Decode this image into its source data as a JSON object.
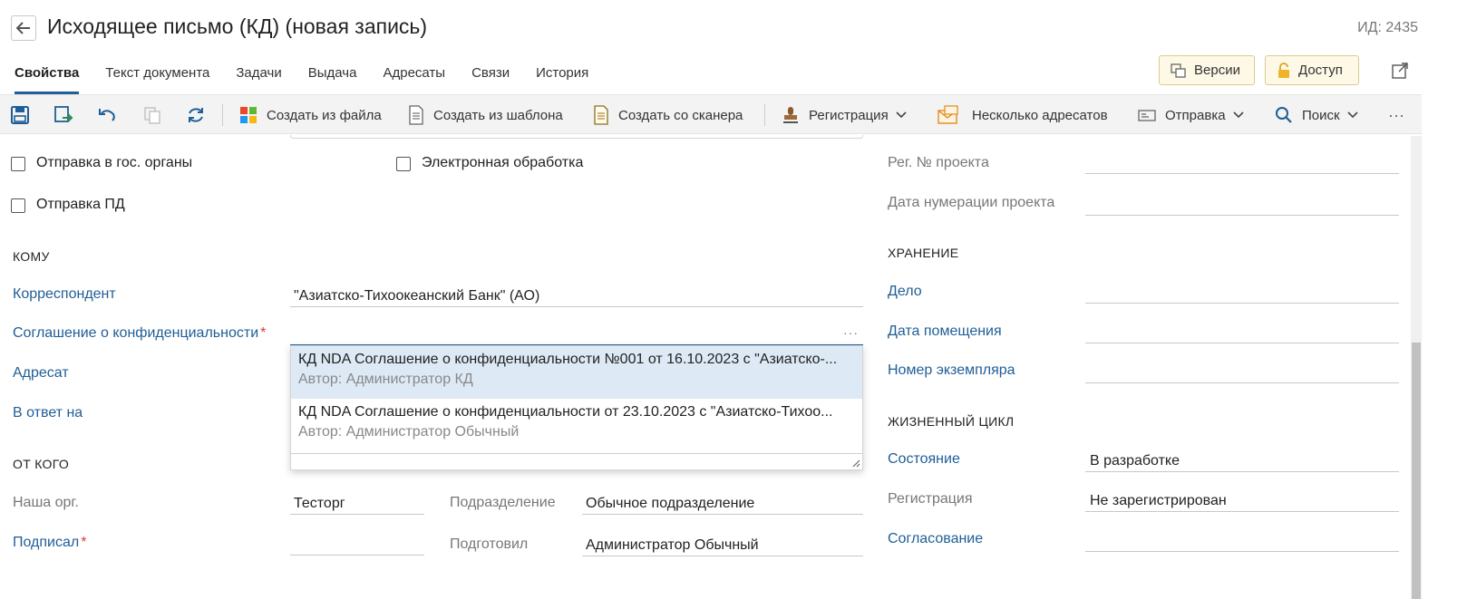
{
  "header": {
    "title": "Исходящее письмо (КД) (новая запись)",
    "id_label": "ИД: 2435"
  },
  "tabs": [
    {
      "label": "Свойства",
      "active": true
    },
    {
      "label": "Текст документа"
    },
    {
      "label": "Задачи"
    },
    {
      "label": "Выдача"
    },
    {
      "label": "Адресаты"
    },
    {
      "label": "Связи"
    },
    {
      "label": "История"
    }
  ],
  "header_buttons": {
    "versions": "Версии",
    "access": "Доступ"
  },
  "toolbar": {
    "create_from_file": "Создать из файла",
    "create_from_template": "Создать из шаблона",
    "create_from_scanner": "Создать со сканера",
    "registration": "Регистрация",
    "multiple_recipients": "Несколько адресатов",
    "sending": "Отправка",
    "search": "Поиск",
    "more": "···"
  },
  "checkboxes": {
    "gov_sending": "Отправка в гос. органы",
    "electronic_processing": "Электронная обработка",
    "pd_sending": "Отправка ПД"
  },
  "sections": {
    "to": "КОМУ",
    "from": "ОТ КОГО",
    "storage": "ХРАНЕНИЕ",
    "lifecycle": "ЖИЗНЕННЫЙ ЦИКЛ"
  },
  "fields": {
    "correspondent_label": "Корреспондент",
    "correspondent_value": "\"Азиатско-Тихоокеанский Банк\" (АО)",
    "nda_label": "Соглашение о конфиденциальности",
    "addressee_label": "Адресат",
    "reply_to_label": "В ответ на",
    "our_org_label": "Наша орг.",
    "our_org_value": "Тесторг",
    "department_label": "Подразделение",
    "department_value": "Обычное подразделение",
    "signed_label": "Подписал",
    "prepared_label": "Подготовил",
    "prepared_value": "Администратор Обычный",
    "reg_no_label": "Рег. № проекта",
    "numbering_date_label": "Дата нумерации проекта",
    "case_label": "Дело",
    "placement_date_label": "Дата помещения",
    "copy_number_label": "Номер экземпляра",
    "state_label": "Состояние",
    "state_value": "В разработке",
    "registration_label": "Регистрация",
    "registration_value": "Не зарегистрирован",
    "approval_label": "Согласование",
    "required_mark": "*",
    "ellipsis": "···"
  },
  "dropdown": {
    "items": [
      {
        "title": "КД NDA Соглашение о конфиденциальности №001 от 16.10.2023 с \"Азиатско-...",
        "author": "Автор: Администратор КД",
        "selected": true
      },
      {
        "title": "КД NDA Соглашение о конфиденциальности от 23.10.2023 с \"Азиатско-Тихоо...",
        "author": "Автор: Администратор Обычный",
        "selected": false
      }
    ]
  },
  "colors": {
    "accent": "#1f5e96",
    "required": "#e03a3a",
    "selected_row": "#ddeaf6",
    "toolbar_bg": "#f3f3f3",
    "header_button_bg": "#fdf9e6"
  }
}
